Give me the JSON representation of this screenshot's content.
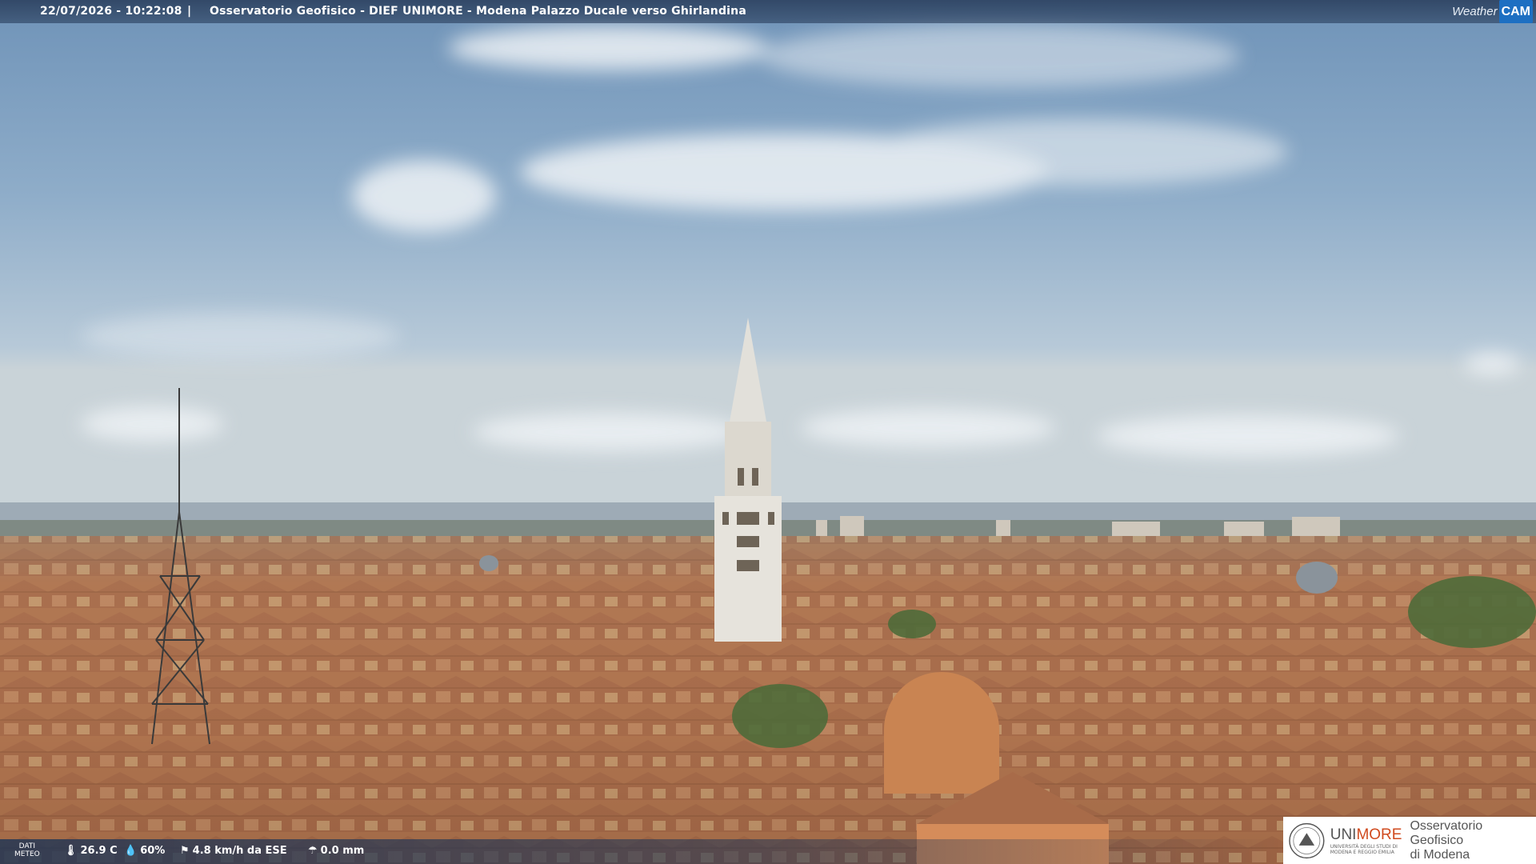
{
  "header": {
    "timestamp": "22/07/2026 - 10:22:08",
    "separator": "|",
    "title": "Osservatorio Geofisico - DIEF UNIMORE - Modena Palazzo Ducale verso Ghirlandina"
  },
  "brand": {
    "weather_label": "Weather",
    "cam_label": "CAM",
    "cam_color": "#1d6fc2"
  },
  "weather": {
    "label_line1": "DATI",
    "label_line2": "METEO",
    "temperature": "26.9 C",
    "humidity": "60%",
    "wind": "4.8 km/h da ESE",
    "rain": "0.0 mm",
    "icons": [
      "thermometer-icon",
      "humidity-drop-icon",
      "wind-icon",
      "rain-icon"
    ]
  },
  "logo": {
    "uni_prefix": "UNI",
    "uni_suffix": "MORE",
    "uni_sub1": "UNIVERSITÀ DEGLI STUDI DI",
    "uni_sub2": "MODENA E REGGIO EMILIA",
    "observatory_line1": "Osservatorio Geofisico",
    "observatory_line2": "di Modena",
    "accent": "#d04a1e"
  }
}
